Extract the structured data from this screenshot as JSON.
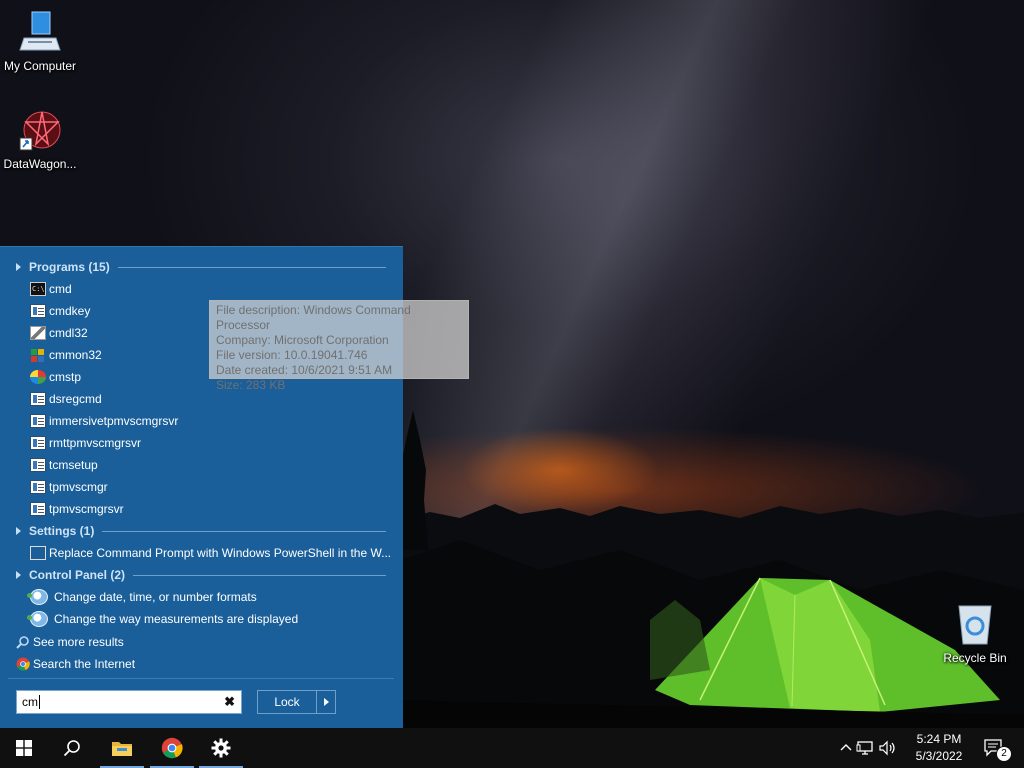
{
  "desktop": {
    "icons": [
      {
        "label": "My Computer",
        "icon": "monitor-icon"
      },
      {
        "label": "DataWagon...",
        "icon": "datawagon-icon"
      },
      {
        "label": "Recycle Bin",
        "icon": "recycle-bin-icon"
      }
    ]
  },
  "start_menu": {
    "groups": {
      "programs": {
        "header": "Programs (15)",
        "items": [
          {
            "label": "cmd",
            "icon": "cmd-icon"
          },
          {
            "label": "cmdkey",
            "icon": "app-window-icon"
          },
          {
            "label": "cmdl32",
            "icon": "cmdl32-icon"
          },
          {
            "label": "cmmon32",
            "icon": "cmmon32-icon"
          },
          {
            "label": "cmstp",
            "icon": "cmstp-icon"
          },
          {
            "label": "dsregcmd",
            "icon": "app-window-icon"
          },
          {
            "label": "immersivetpmvscmgrsvr",
            "icon": "app-window-icon"
          },
          {
            "label": "rmttpmvscmgrsvr",
            "icon": "app-window-icon"
          },
          {
            "label": "tcmsetup",
            "icon": "app-window-icon"
          },
          {
            "label": "tpmvscmgr",
            "icon": "app-window-icon"
          },
          {
            "label": "tpmvscmgrsvr",
            "icon": "app-window-icon"
          }
        ]
      },
      "settings": {
        "header": "Settings (1)",
        "items": [
          {
            "label": "Replace Command Prompt with Windows PowerShell in the W...",
            "icon": "taskbar-settings-icon"
          }
        ]
      },
      "control_panel": {
        "header": "Control Panel (2)",
        "items": [
          {
            "label": "Change date, time, or number formats",
            "icon": "region-clock-icon"
          },
          {
            "label": "Change the way measurements are displayed",
            "icon": "region-clock-icon"
          }
        ]
      }
    },
    "see_more": "See more results",
    "search_internet": "Search the Internet",
    "search_value": "cm",
    "clear_glyph": "✖",
    "lock_label": "Lock",
    "tooltip": {
      "description": "File description: Windows Command Processor",
      "company": "Company: Microsoft Corporation",
      "version": "File version: 10.0.19041.746",
      "created": "Date created: 10/6/2021 9:51 AM",
      "size": "Size: 283 KB"
    }
  },
  "taskbar": {
    "time": "5:24 PM",
    "date": "5/3/2022",
    "notification_count": "2",
    "apps": [
      "start-button",
      "search-button",
      "file-explorer",
      "chrome",
      "settings"
    ]
  },
  "colors": {
    "menu_bg": "#1a5f9a",
    "taskbar_bg": "#101010",
    "group_header": "#cfe3f7"
  }
}
